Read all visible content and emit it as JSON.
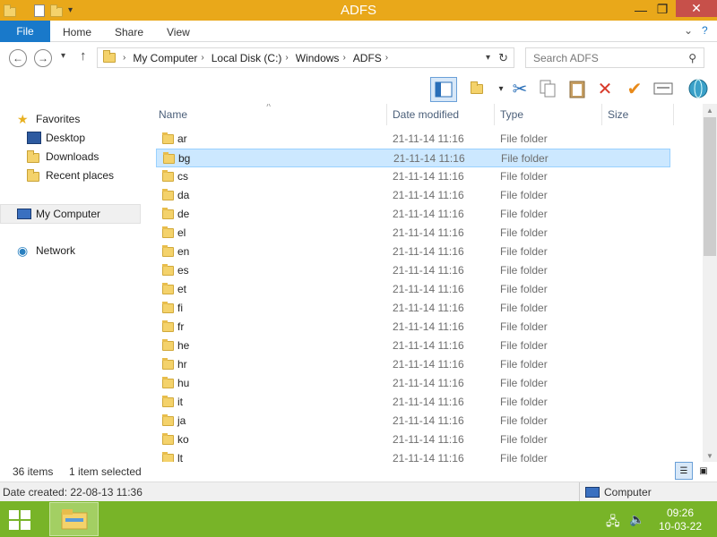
{
  "window": {
    "title": "ADFS",
    "minimize": "—",
    "maximize": "❐",
    "close": "✕"
  },
  "ribbon": {
    "tabs": [
      "File",
      "Home",
      "Share",
      "View"
    ],
    "help": "?",
    "expand": "⌄"
  },
  "nav": {
    "back": "←",
    "forward": "→",
    "recent": "▾",
    "up": "↑",
    "breadcrumb": [
      "My Computer",
      "Local Disk (C:)",
      "Windows",
      "ADFS"
    ],
    "refresh": "↻",
    "search_placeholder": "Search ADFS"
  },
  "navpane": {
    "favorites": "Favorites",
    "desktop": "Desktop",
    "downloads": "Downloads",
    "recent_places": "Recent places",
    "my_computer": "My Computer",
    "network": "Network"
  },
  "columns": {
    "name": "Name",
    "date": "Date modified",
    "type": "Type",
    "size": "Size"
  },
  "files": [
    {
      "name": "ar",
      "date": "21-11-14 11:16",
      "type": "File folder"
    },
    {
      "name": "bg",
      "date": "21-11-14 11:16",
      "type": "File folder",
      "selected": true
    },
    {
      "name": "cs",
      "date": "21-11-14 11:16",
      "type": "File folder"
    },
    {
      "name": "da",
      "date": "21-11-14 11:16",
      "type": "File folder"
    },
    {
      "name": "de",
      "date": "21-11-14 11:16",
      "type": "File folder"
    },
    {
      "name": "el",
      "date": "21-11-14 11:16",
      "type": "File folder"
    },
    {
      "name": "en",
      "date": "21-11-14 11:16",
      "type": "File folder"
    },
    {
      "name": "es",
      "date": "21-11-14 11:16",
      "type": "File folder"
    },
    {
      "name": "et",
      "date": "21-11-14 11:16",
      "type": "File folder"
    },
    {
      "name": "fi",
      "date": "21-11-14 11:16",
      "type": "File folder"
    },
    {
      "name": "fr",
      "date": "21-11-14 11:16",
      "type": "File folder"
    },
    {
      "name": "he",
      "date": "21-11-14 11:16",
      "type": "File folder"
    },
    {
      "name": "hr",
      "date": "21-11-14 11:16",
      "type": "File folder"
    },
    {
      "name": "hu",
      "date": "21-11-14 11:16",
      "type": "File folder"
    },
    {
      "name": "it",
      "date": "21-11-14 11:16",
      "type": "File folder"
    },
    {
      "name": "ja",
      "date": "21-11-14 11:16",
      "type": "File folder"
    },
    {
      "name": "ko",
      "date": "21-11-14 11:16",
      "type": "File folder"
    },
    {
      "name": "lt",
      "date": "21-11-14 11:16",
      "type": "File folder"
    }
  ],
  "status": {
    "item_count": "36 items",
    "selection": "1 item selected",
    "date_created": "Date created: 22-08-13 11:36",
    "location": "Computer"
  },
  "taskbar": {
    "time": "09:26",
    "date": "10-03-22"
  },
  "colors": {
    "titlebar": "#e9a81a",
    "file_tab": "#1979ca",
    "taskbar": "#78b428",
    "selection": "#cce8ff"
  }
}
